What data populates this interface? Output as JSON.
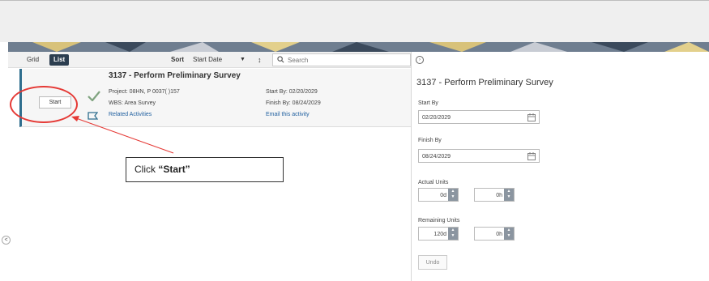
{
  "toolbar": {
    "grid_label": "Grid",
    "list_label": "List",
    "sort_label": "Sort",
    "sort_value": "Start Date",
    "search_placeholder": "Search"
  },
  "activity": {
    "title": "3137 - Perform Preliminary Survey",
    "start_button": "Start",
    "project": "Project: 08HN, P 0037( )157",
    "wbs": "WBS: Area Survey",
    "start_by": "Start By: 02/20/2029",
    "finish_by": "Finish By: 08/24/2029",
    "related_link": "Related Activities",
    "email_link": "Email this activity"
  },
  "callout": {
    "prefix": "Click ",
    "action": "“Start”"
  },
  "detail": {
    "title": "3137 - Perform Preliminary Survey",
    "start_by_label": "Start By",
    "start_by_value": "02/20/2029",
    "finish_by_label": "Finish By",
    "finish_by_value": "08/24/2029",
    "actual_units_label": "Actual Units",
    "actual_units_day": "0d",
    "actual_units_hour": "0h",
    "remaining_units_label": "Remaining Units",
    "remaining_units_day": "120d",
    "remaining_units_hour": "0h",
    "undo_label": "Undo"
  },
  "colors": {
    "accent_dark": "#2c3e50",
    "card_border": "#2f6e8e",
    "link": "#1f5f9f",
    "highlight": "#e53935",
    "check": "#7fa37f"
  },
  "icons": [
    "search-icon",
    "check-icon",
    "flag-icon",
    "calendar-icon",
    "info-icon",
    "chevron-left-icon",
    "sort-order-icon",
    "caret-down-icon"
  ]
}
